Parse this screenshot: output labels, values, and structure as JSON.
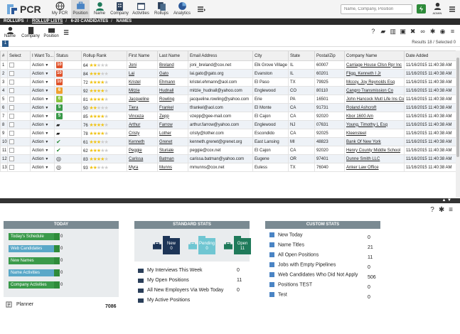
{
  "app": {
    "logo_text": "PCR"
  },
  "nav": [
    {
      "label": "My PCR",
      "icon": "globe-icon"
    },
    {
      "label": "Position",
      "icon": "briefcase-icon"
    },
    {
      "label": "Name",
      "icon": "person-icon"
    },
    {
      "label": "Company",
      "icon": "building-icon"
    },
    {
      "label": "Activities",
      "icon": "calendar-icon"
    },
    {
      "label": "Rollups",
      "icon": "rollups-icon"
    },
    {
      "label": "Analytics",
      "icon": "analytics-icon"
    }
  ],
  "search": {
    "placeholder": "Name, Company, Position"
  },
  "user": {
    "label": "ADMIN"
  },
  "breadcrumb": [
    "ROLLUPS",
    "ROLLUP LISTS",
    "6-20 CANDIDATES",
    "NAMES"
  ],
  "subtoolbar": [
    "Name",
    "Company",
    "Position"
  ],
  "pager": {
    "page": "1",
    "results": "Results 18 / Selected 0"
  },
  "grid": {
    "headers": [
      "#",
      "Select",
      "I Want To...",
      "Status",
      "Rollup Rank",
      "First Name",
      "Last Name",
      "Email Address",
      "City",
      "State",
      "Postal/Zip",
      "Company Name",
      "Date Added"
    ],
    "action_label": "Action",
    "rows": [
      {
        "n": "1",
        "status": "10",
        "sc": "#e0522a",
        "rank": 64,
        "stars": 2,
        "first": "Joni",
        "last": "Breland",
        "email": "joni_breland@cox.net",
        "city": "Elk Grove Village",
        "state": "IL",
        "zip": "60007",
        "company": "Carriage House Cllsn Rpr Inc",
        "date": "11/16/2015 11:40:38 AM"
      },
      {
        "n": "2",
        "status": "10",
        "sc": "#e0522a",
        "rank": 84,
        "stars": 3,
        "first": "Lai",
        "last": "Gato",
        "email": "lai.gato@gato.org",
        "city": "Evanston",
        "state": "IL",
        "zip": "60201",
        "company": "Fligg, Kenneth I Jr",
        "date": "11/16/2015 11:40:38 AM"
      },
      {
        "n": "3",
        "status": "10",
        "sc": "#e0522a",
        "rank": 72,
        "stars": 4,
        "first": "Kristel",
        "last": "Ehmann",
        "email": "kristel.ehmann@aol.com",
        "city": "El Paso",
        "state": "TX",
        "zip": "79925",
        "company": "Mccoy, Joy Reynolds Esq",
        "date": "11/16/2015 11:40:38 AM"
      },
      {
        "n": "4",
        "status": "6",
        "sc": "#f0a030",
        "rank": 92,
        "stars": 4,
        "first": "Mitzie",
        "last": "Hudnall",
        "email": "mitzie_hudnall@yahoo.com",
        "city": "Englewood",
        "state": "CO",
        "zip": "80110",
        "company": "Cangro Transmission Co",
        "date": "11/16/2015 11:40:38 AM"
      },
      {
        "n": "5",
        "status": "6",
        "sc": "#8ac43f",
        "rank": 81,
        "stars": 4,
        "first": "Jacqueline",
        "last": "Rowling",
        "email": "jacqueline.rowling@yahoo.com",
        "city": "Erie",
        "state": "PA",
        "zip": "16501",
        "company": "John Hancock Mutl Life Ins Co",
        "date": "11/16/2015 11:40:38 AM"
      },
      {
        "n": "6",
        "status": "5",
        "sc": "#3a9a4a",
        "rank": 50,
        "stars": 2,
        "first": "Tiera",
        "last": "Frankel",
        "email": "tfrankel@aol.com",
        "city": "El Monte",
        "state": "CA",
        "zip": "91731",
        "company": "Roland Ashcroft",
        "date": "11/16/2015 11:40:38 AM"
      },
      {
        "n": "7",
        "status": "5",
        "sc": "#3a9a4a",
        "rank": 85,
        "stars": 4,
        "first": "Vinceza",
        "last": "Zepp",
        "email": "vzepp@gee-mail.com",
        "city": "El Cajon",
        "state": "CA",
        "zip": "92020",
        "company": "Kbor 1600 Am",
        "date": "11/16/2015 11:40:38 AM"
      },
      {
        "n": "8",
        "status": "",
        "sc": "folder",
        "rank": 76,
        "stars": 4,
        "first": "Arthur",
        "last": "Farrow",
        "email": "arthur.farrow@yahoo.com",
        "city": "Englewood",
        "state": "NJ",
        "zip": "07631",
        "company": "Young, Timothy L Esq",
        "date": "11/16/2015 11:40:38 AM"
      },
      {
        "n": "9",
        "status": "",
        "sc": "folder",
        "rank": 78,
        "stars": 4,
        "first": "Cristy",
        "last": "Lother",
        "email": "cristy@lother.com",
        "city": "Escondido",
        "state": "CA",
        "zip": "92025",
        "company": "Kleensteel",
        "date": "11/16/2015 11:40:38 AM"
      },
      {
        "n": "10",
        "status": "",
        "sc": "check",
        "rank": 61,
        "stars": 3,
        "first": "Kenneth",
        "last": "Grenet",
        "email": "kenneth.grenet@grenet.org",
        "city": "East Lansing",
        "state": "MI",
        "zip": "48823",
        "company": "Bank Of New York",
        "date": "11/16/2015 11:40:38 AM"
      },
      {
        "n": "11",
        "status": "",
        "sc": "check",
        "rank": 62,
        "stars": 3,
        "first": "Peggie",
        "last": "Sturiale",
        "email": "peggie@cox.net",
        "city": "El Cajon",
        "state": "CA",
        "zip": "92020",
        "company": "Henry County Middle School",
        "date": "11/16/2015 11:40:38 AM"
      },
      {
        "n": "12",
        "status": "",
        "sc": "target",
        "rank": 83,
        "stars": 4,
        "first": "Carissa",
        "last": "Batman",
        "email": "carissa.batman@yahoo.com",
        "city": "Eugene",
        "state": "OR",
        "zip": "97401",
        "company": "Dunne Smith LLC",
        "date": "11/16/2015 11:40:38 AM"
      },
      {
        "n": "13",
        "status": "",
        "sc": "target",
        "rank": 93,
        "stars": 2,
        "first": "Myra",
        "last": "Munns",
        "email": "mmunns@cox.net",
        "city": "Euless",
        "state": "TX",
        "zip": "76040",
        "company": "Anker Law Office",
        "date": "11/16/2015 11:40:38 AM"
      }
    ]
  },
  "today": {
    "title": "TODAY",
    "items": [
      {
        "label": "Today's Schedule",
        "value": "0",
        "color": "#3a9a4a"
      },
      {
        "label": "Web Candidates",
        "value": "0",
        "color": "#5aa8c8"
      },
      {
        "label": "New Names",
        "value": "0",
        "color": "#3a9a4a"
      },
      {
        "label": "Name Activities",
        "value": "0",
        "color": "#5aa8c8"
      },
      {
        "label": "Company Activities",
        "value": "0",
        "color": "#3a9a4a"
      }
    ],
    "planner_label": "Planner",
    "planner_value": "7086"
  },
  "standard": {
    "title": "STANDARD STATS",
    "folders": [
      {
        "label": "New",
        "value": "0",
        "color": "#1d3557"
      },
      {
        "label": "Pending",
        "value": "0",
        "color": "#6fc6d2"
      },
      {
        "label": "Open",
        "value": "11",
        "color": "#1f7a5a"
      }
    ],
    "rows": [
      {
        "label": "My Interviews This Week",
        "value": "0"
      },
      {
        "label": "My Open Positions",
        "value": "11"
      },
      {
        "label": "All New Employers Via Web Today",
        "value": "0"
      },
      {
        "label": "My Active Positions",
        "value": ""
      }
    ]
  },
  "custom": {
    "title": "CUSTOM STATS",
    "rows": [
      {
        "label": "New Today",
        "value": "0"
      },
      {
        "label": "Name Titles",
        "value": "21"
      },
      {
        "label": "All Open Positions",
        "value": "11"
      },
      {
        "label": "Jobs with Empty Pipelines",
        "value": "0"
      },
      {
        "label": "Web Candidates Who Did Not Apply",
        "value": "506"
      },
      {
        "label": "Positions TEST",
        "value": "0"
      },
      {
        "label": "Test",
        "value": "0"
      }
    ]
  }
}
